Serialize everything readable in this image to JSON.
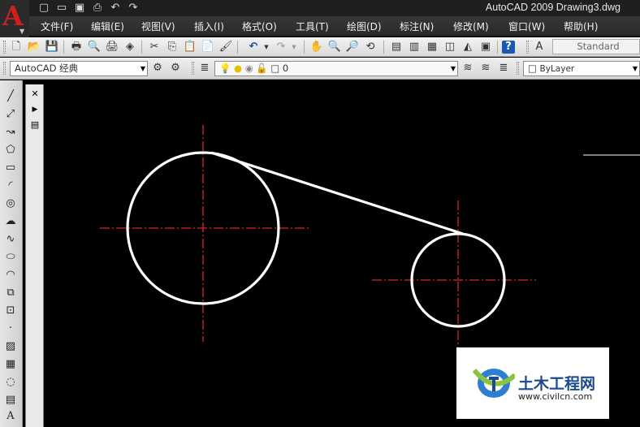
{
  "window": {
    "title": "AutoCAD 2009  Drawing3.dwg",
    "logo_letter": "A"
  },
  "quick_access": [
    {
      "icon": "new-file-icon",
      "glyph": "🗋"
    },
    {
      "icon": "open-folder-icon",
      "glyph": "📂"
    },
    {
      "icon": "save-icon",
      "glyph": "💾"
    },
    {
      "icon": "print-icon",
      "glyph": "🖶"
    },
    {
      "icon": "undo-icon",
      "glyph": "↶"
    },
    {
      "icon": "redo-icon",
      "glyph": "↷"
    }
  ],
  "menu": [
    "文件(F)",
    "编辑(E)",
    "视图(V)",
    "插入(I)",
    "格式(O)",
    "工具(T)",
    "绘图(D)",
    "标注(N)",
    "修改(M)",
    "窗口(W)",
    "帮助(H)"
  ],
  "toolbar": {
    "text_style": "Standard",
    "workspace": "AutoCAD 经典",
    "layer": "0",
    "color": "ByLayer"
  },
  "draw_tools": [
    {
      "name": "line-icon",
      "glyph": "╱"
    },
    {
      "name": "construction-line-icon",
      "glyph": "⤢"
    },
    {
      "name": "polyline-icon",
      "glyph": "↝"
    },
    {
      "name": "polygon-icon",
      "glyph": "⬠"
    },
    {
      "name": "rectangle-icon",
      "glyph": "▭"
    },
    {
      "name": "arc-icon",
      "glyph": "◜"
    },
    {
      "name": "circle-icon",
      "glyph": "◎"
    },
    {
      "name": "revision-cloud-icon",
      "glyph": "☁"
    },
    {
      "name": "spline-icon",
      "glyph": "∿"
    },
    {
      "name": "ellipse-icon",
      "glyph": "⬭"
    },
    {
      "name": "ellipse-arc-icon",
      "glyph": "◠"
    },
    {
      "name": "insert-block-icon",
      "glyph": "⧉"
    },
    {
      "name": "make-block-icon",
      "glyph": "⊡"
    },
    {
      "name": "point-icon",
      "glyph": "·"
    },
    {
      "name": "hatch-icon",
      "glyph": "▨"
    },
    {
      "name": "gradient-icon",
      "glyph": "▦"
    },
    {
      "name": "region-icon",
      "glyph": "◌"
    },
    {
      "name": "table-icon",
      "glyph": "▤"
    },
    {
      "name": "multiline-text-icon",
      "glyph": "A"
    }
  ],
  "palette_tools": [
    {
      "name": "close-icon",
      "glyph": "✕"
    },
    {
      "name": "autohide-icon",
      "glyph": "▶"
    },
    {
      "name": "properties-icon",
      "glyph": "▤"
    }
  ],
  "watermark": {
    "text": "土木工程网",
    "url": "www.civilcn.com"
  },
  "colors": {
    "canvas": "#000000",
    "geometry": "#ffffff",
    "centerline": "#d6262b",
    "accent": "#d11f1f"
  }
}
